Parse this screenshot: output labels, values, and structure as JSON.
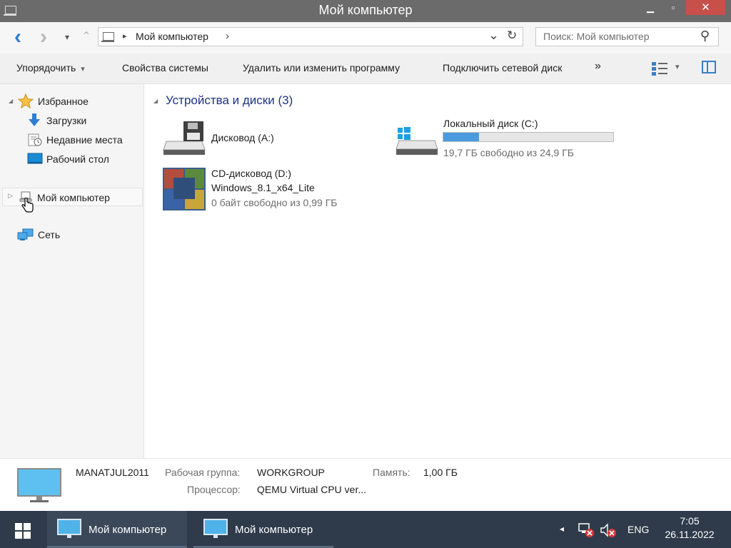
{
  "window": {
    "title": "Мой компьютер",
    "minimize_glyph": "▁",
    "maximize_glyph": "▫",
    "close_glyph": "✕"
  },
  "nav": {
    "back_glyph": "‹",
    "forward_glyph": "›",
    "recent_glyph": "▾",
    "up_glyph": "⌃",
    "breadcrumb_sep": "▸",
    "breadcrumb": "Мой компьютер",
    "breadcrumb_arrow": "›",
    "dropdown_glyph": "⌄",
    "refresh_glyph": "↻",
    "search_placeholder": "Поиск: Мой компьютер",
    "search_glyph": "⚲"
  },
  "commands": {
    "organize": "Упорядочить",
    "organize_arrow": "▾",
    "system_properties": "Свойства системы",
    "uninstall": "Удалить или изменить программу",
    "map_drive": "Подключить сетевой диск",
    "more": "»",
    "view_arrow": "▾"
  },
  "navpane": {
    "favorites": "Избранное",
    "downloads": "Загрузки",
    "recent": "Недавние места",
    "desktop": "Рабочий стол",
    "computer": "Мой компьютер",
    "network": "Сеть",
    "expand_glyph": "◢",
    "collapsed_glyph": "▷"
  },
  "content": {
    "group_header": "Устройства и диски (3)",
    "group_glyph": "◢",
    "drives": [
      {
        "name": "Дисковод (A:)"
      },
      {
        "name": "Локальный диск (C:)",
        "free": "19,7 ГБ свободно из 24,9 ГБ",
        "used_fraction": 0.21
      },
      {
        "name": "CD-дисковод (D:)",
        "label": "Windows_8.1_x64_Lite",
        "free": "0 байт свободно из 0,99 ГБ"
      }
    ]
  },
  "details": {
    "computer_name": "MANATJUL2011",
    "workgroup_label": "Рабочая группа:",
    "workgroup_value": "WORKGROUP",
    "memory_label": "Память:",
    "memory_value": "1,00 ГБ",
    "cpu_label": "Процессор:",
    "cpu_value": "QEMU Virtual CPU ver..."
  },
  "taskbar": {
    "app1": "Мой компьютер",
    "app2": "Мой компьютер",
    "tray_arrow": "◂",
    "language": "ENG",
    "time": "7:05",
    "date": "26.11.2022"
  },
  "colors": {
    "titlebar": "#6b6b6b",
    "close_button": "#c7504b",
    "group_header": "#1e3287",
    "progress": "#4a9ae0",
    "taskbar": "#2f3b4a",
    "monitor": "#4fb2e8"
  }
}
